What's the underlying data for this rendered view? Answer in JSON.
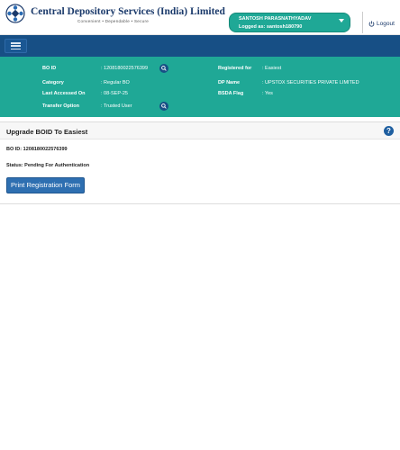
{
  "header": {
    "brand_name": "Central Depository Services (India) Limited",
    "brand_tagline": "Convenient  •  Dependable  •  Secure",
    "user": {
      "name": "SANTOSH PARASNATHYADAV",
      "logged_as": "Logged as: santosh180790"
    },
    "logout_label": "Logout"
  },
  "info": {
    "bo_id_label": "BO ID",
    "bo_id_value": ": 1208180022576399",
    "category_label": "Category",
    "category_value": ": Regular BO",
    "last_accessed_label": "Last Accessed On",
    "last_accessed_value": ": 08-SEP-25",
    "transfer_label": "Transfer Option",
    "transfer_value": ": Trusted User",
    "registered_label": "Registered for",
    "registered_value": ": Easiest",
    "dp_name_label": "DP Name",
    "dp_name_value": ": UPSTOX SECURITIES PRIVATE LIMITED",
    "bsda_label": "BSDA Flag",
    "bsda_value": ": Yes"
  },
  "card": {
    "title": "Upgrade BOID To Easiest",
    "help_glyph": "?",
    "bo_id_line": "BO ID: 1208180022576399",
    "status_line": "Status: Pending For Authentication",
    "print_button": "Print Registration Form"
  },
  "colors": {
    "teal": "#1fa896",
    "navy": "#174f85",
    "button_blue": "#2e6fb1"
  },
  "icons": [
    "cdsl-logo-icon",
    "chevron-down-icon",
    "power-icon",
    "hamburger-icon",
    "search-icon",
    "help-icon"
  ]
}
